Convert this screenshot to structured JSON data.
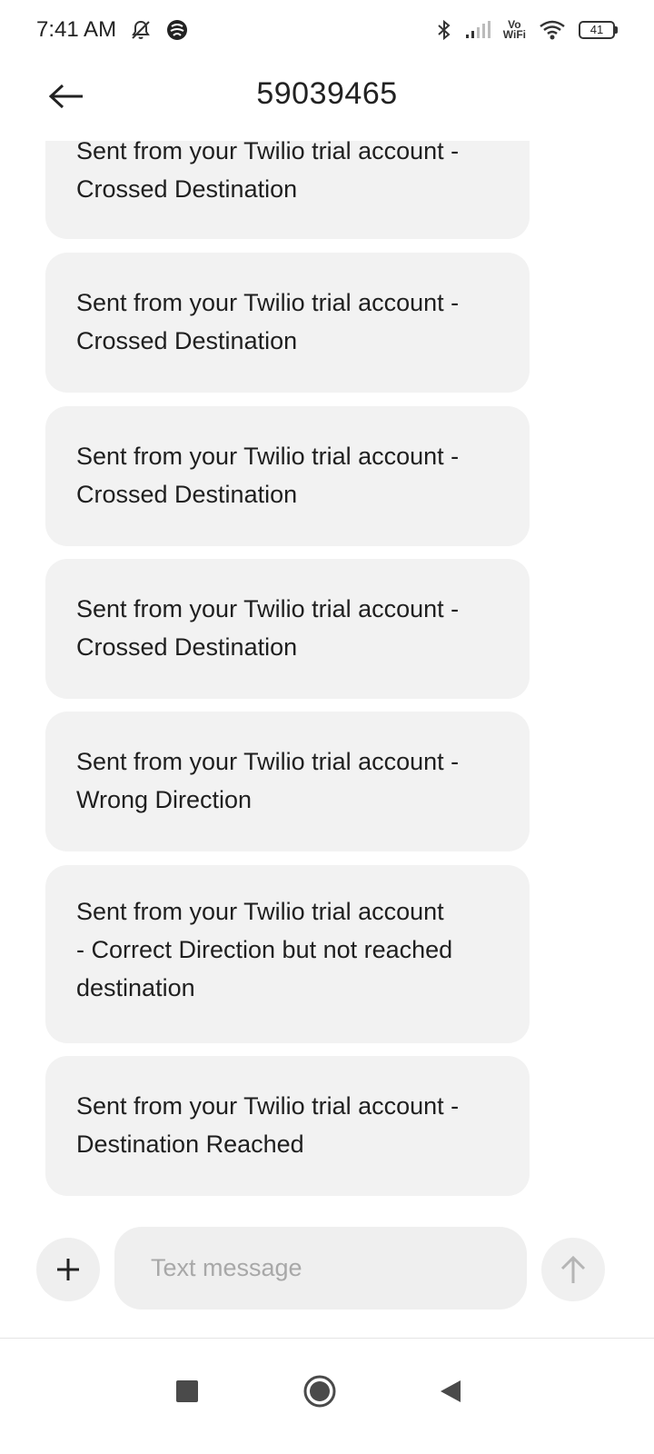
{
  "status_bar": {
    "time": "7:41 AM",
    "battery_level": "41",
    "network_label_top": "Vo",
    "network_label_bottom": "WiFi",
    "icons": [
      "mute-notifications-icon",
      "vpn-icon",
      "bluetooth-icon",
      "signal-icon",
      "vowifi-icon",
      "wifi-icon",
      "battery-icon"
    ]
  },
  "header": {
    "title": "59039465",
    "back_icon": "back-arrow-icon"
  },
  "messages": [
    {
      "text": "Sent from your Twilio trial account -\nCrossed Destination"
    },
    {
      "text": "Sent from your Twilio trial account -\nCrossed Destination"
    },
    {
      "text": "Sent from your Twilio trial account -\nCrossed Destination"
    },
    {
      "text": "Sent from your Twilio trial account -\nCrossed Destination"
    },
    {
      "text": "Sent from your Twilio trial account -\nWrong Direction"
    },
    {
      "text": "Sent from your Twilio trial account\n- Correct Direction but not reached\ndestination"
    },
    {
      "text": "Sent from your Twilio trial account -\nDestination Reached"
    }
  ],
  "composer": {
    "placeholder": "Text message",
    "attach_icon": "plus-icon",
    "send_icon": "send-arrow-icon"
  },
  "nav_bar": {
    "icons": [
      "recents-square-icon",
      "home-circle-icon",
      "back-triangle-icon"
    ]
  },
  "colors": {
    "bubble_bg": "#f2f2f2",
    "input_bg": "#efefef",
    "placeholder": "#a8a8a8",
    "text": "#1f1f1f",
    "nav_icons": "#4a4a4a"
  }
}
